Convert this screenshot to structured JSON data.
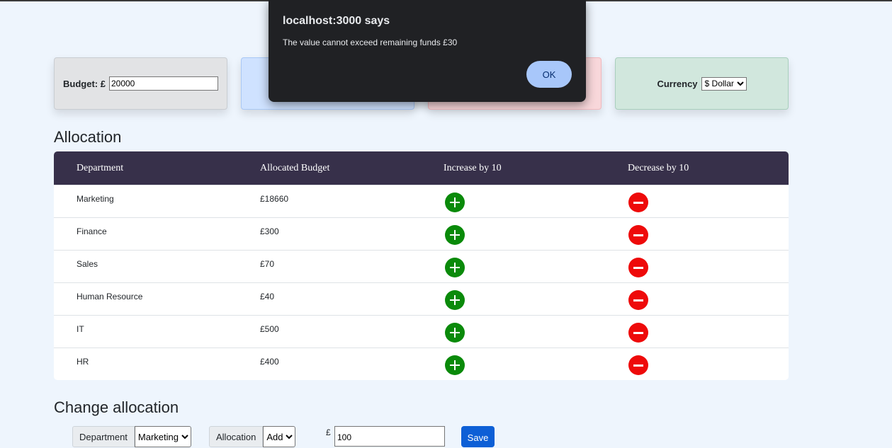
{
  "dialog": {
    "title": "localhost:3000 says",
    "message": "The value cannot exceed remaining funds  £30",
    "ok_label": "OK"
  },
  "budget": {
    "label": "Budget: £",
    "value": "20000"
  },
  "currency": {
    "label": "Currency",
    "selected": "$ Dollar"
  },
  "allocation": {
    "title": "Allocation",
    "headers": [
      "Department",
      "Allocated Budget",
      "Increase by 10",
      "Decrease by 10"
    ],
    "rows": [
      {
        "department": "Marketing",
        "budget": "£18660"
      },
      {
        "department": "Finance",
        "budget": "£300"
      },
      {
        "department": "Sales",
        "budget": "£70"
      },
      {
        "department": "Human Resource",
        "budget": "£40"
      },
      {
        "department": "IT",
        "budget": "£500"
      },
      {
        "department": "HR",
        "budget": "£400"
      }
    ]
  },
  "change": {
    "title": "Change allocation",
    "department_label": "Department",
    "department_selected": "Marketing",
    "allocation_label": "Allocation",
    "allocation_selected": "Add",
    "currency_symbol": "£",
    "amount": "100",
    "save_label": "Save"
  },
  "colors": {
    "header_bg": "#37304a",
    "increase": "#0a8a0a",
    "decrease": "#ee0a0a",
    "save": "#0d5fd6"
  }
}
